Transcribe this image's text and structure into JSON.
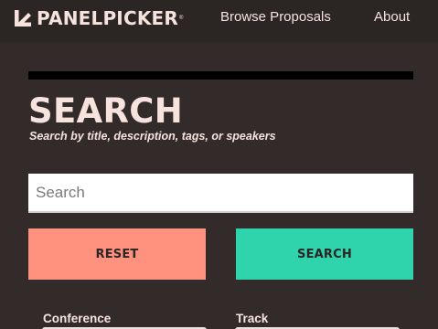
{
  "header": {
    "logo_text": "PANELPICKER",
    "logo_trademark": "®",
    "nav": [
      {
        "label": "Browse Proposals"
      },
      {
        "label": "About"
      }
    ]
  },
  "search": {
    "title": "SEARCH",
    "subtitle": "Search by title, description, tags, or speakers",
    "placeholder": "Search",
    "value": "",
    "reset_label": "RESET",
    "search_label": "SEARCH"
  },
  "filters": {
    "conference_label": "Conference",
    "track_label": "Track"
  },
  "colors": {
    "background": "#332b29",
    "header_background": "#2b2524",
    "text": "#f6e3de",
    "reset_button": "#fe927f",
    "search_button": "#2fd4ad",
    "divider": "#000000"
  },
  "icons": {
    "logo": "arrow-down-left-icon"
  }
}
